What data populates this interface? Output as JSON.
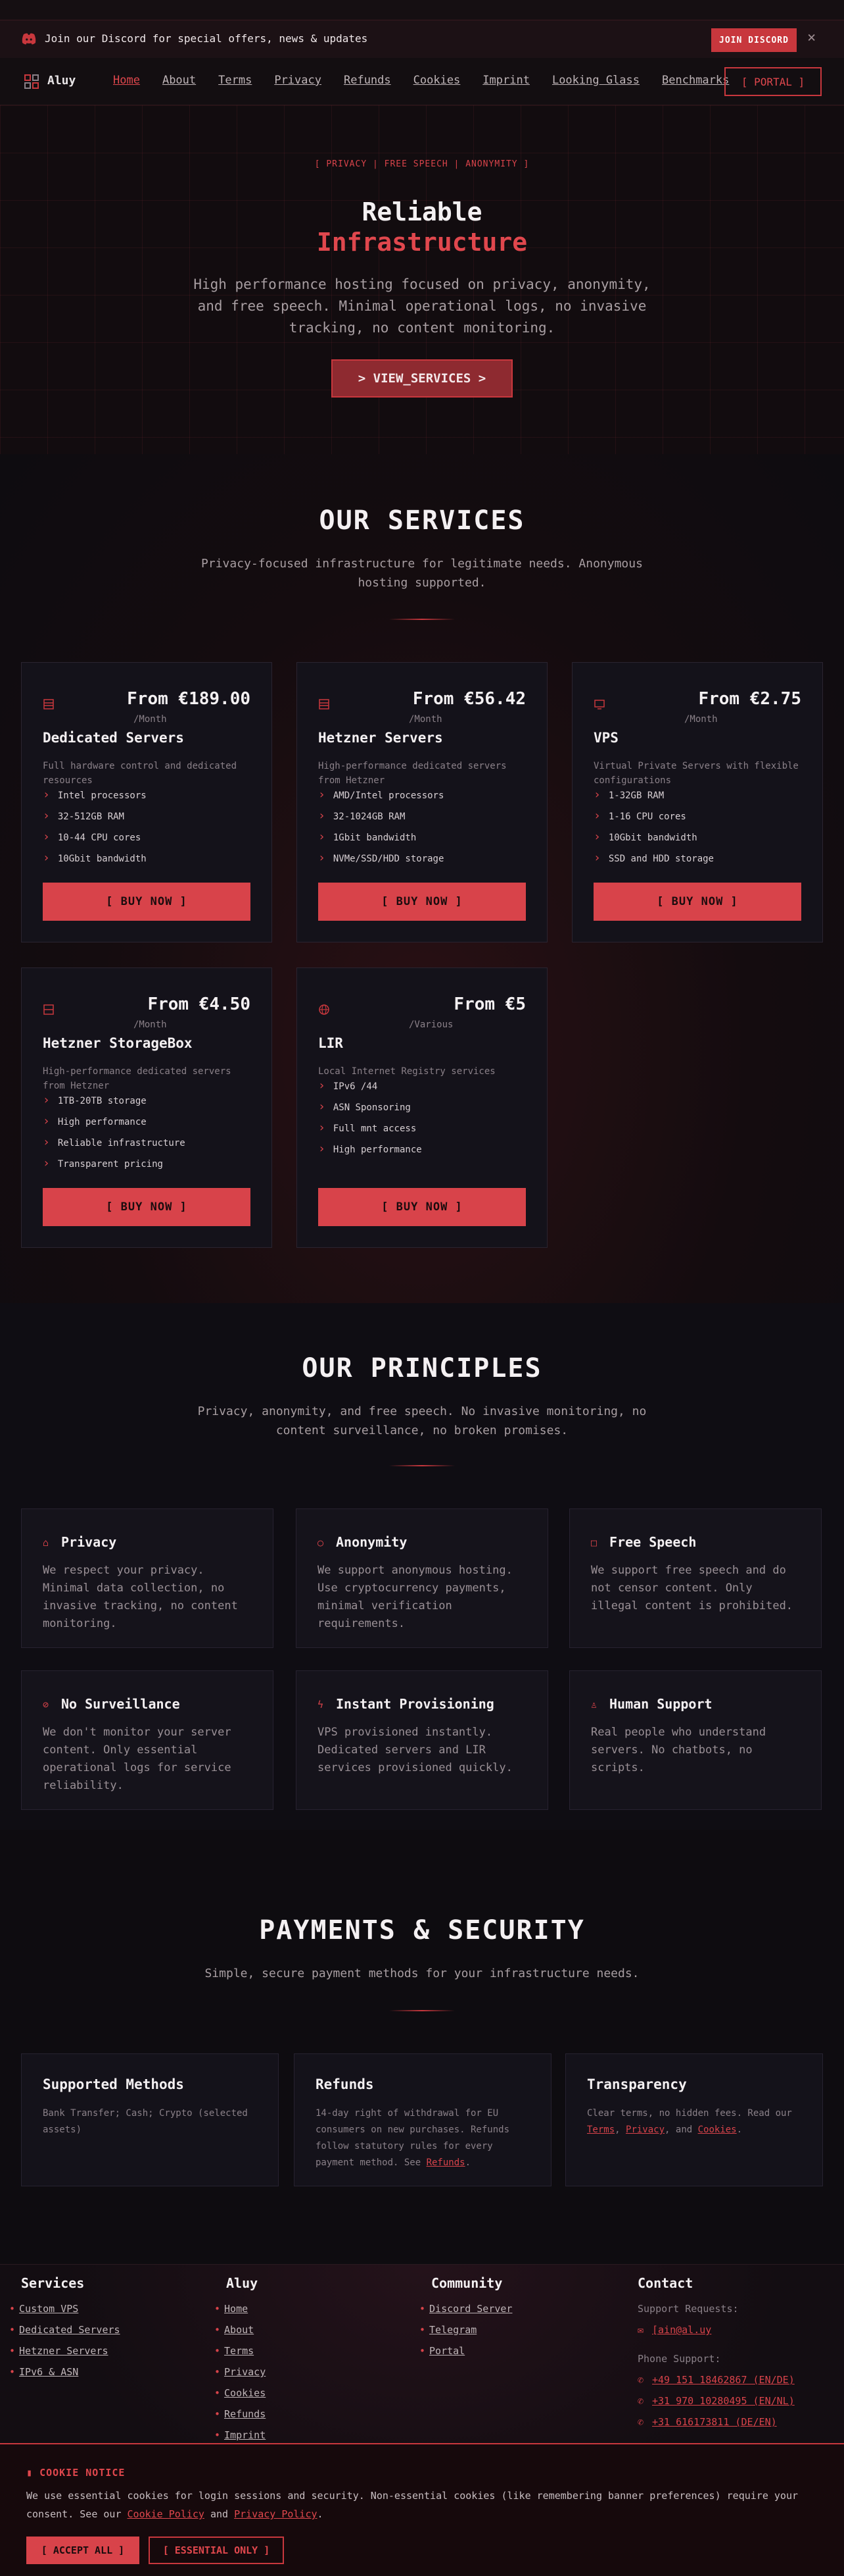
{
  "discord_bar": {
    "text": "Join our Discord for special offers, news & updates",
    "button": "JOIN DISCORD",
    "close": "×"
  },
  "nav": {
    "logo": "Aluy",
    "links": [
      "Home",
      "About",
      "Terms",
      "Privacy",
      "Refunds",
      "Cookies",
      "Imprint",
      "Looking Glass",
      "Benchmarks"
    ],
    "portal": "[ PORTAL ]"
  },
  "hero": {
    "tag": "[ PRIVACY | FREE SPEECH | ANONYMITY ]",
    "title_line1": "Reliable",
    "title_line2": "Infrastructure",
    "subtitle": "High performance hosting focused on privacy, anonymity, and free speech. Minimal operational logs, no invasive tracking, no content monitoring.",
    "cta": "> VIEW_SERVICES >"
  },
  "services": {
    "title": "OUR SERVICES",
    "subtitle": "Privacy-focused infrastructure for legitimate needs. Anonymous hosting supported.",
    "cards": [
      {
        "price": "From €189.00",
        "period": "/Month",
        "title": "Dedicated Servers",
        "desc": "Full hardware control and dedicated resources",
        "features": [
          "Intel processors",
          "32-512GB RAM",
          "10-44 CPU cores",
          "10Gbit bandwidth"
        ],
        "button": "[ BUY NOW ]"
      },
      {
        "price": "From €56.42",
        "period": "/Month",
        "title": "Hetzner Servers",
        "desc": "High-performance dedicated servers from Hetzner",
        "features": [
          "AMD/Intel processors",
          "32-1024GB RAM",
          "1Gbit bandwidth",
          "NVMe/SSD/HDD storage"
        ],
        "button": "[ BUY NOW ]"
      },
      {
        "price": "From €2.75",
        "period": "/Month",
        "title": "VPS",
        "desc": "Virtual Private Servers with flexible configurations",
        "features": [
          "1-32GB RAM",
          "1-16 CPU cores",
          "10Gbit bandwidth",
          "SSD and HDD storage"
        ],
        "button": "[ BUY NOW ]"
      },
      {
        "price": "From €4.50",
        "period": "/Month",
        "title": "Hetzner StorageBox",
        "desc": "High-performance dedicated servers from Hetzner",
        "features": [
          "1TB-20TB storage",
          "High performance",
          "Reliable infrastructure",
          "Transparent pricing"
        ],
        "button": "[ BUY NOW ]"
      },
      {
        "price": "From €5",
        "period": "/Various",
        "title": "LIR",
        "desc": "Local Internet Registry services",
        "features": [
          "IPv6 /44",
          "ASN Sponsoring",
          "Full mnt access",
          "High performance"
        ],
        "button": "[ BUY NOW ]"
      }
    ]
  },
  "principles": {
    "title": "OUR PRINCIPLES",
    "subtitle": "Privacy, anonymity, and free speech. No invasive monitoring, no content surveillance, no broken promises.",
    "cards": [
      {
        "icon": "lock-icon",
        "title": "Privacy",
        "text": "We respect your privacy. Minimal data collection, no invasive tracking, no content monitoring."
      },
      {
        "icon": "mask-icon",
        "title": "Anonymity",
        "text": "We support anonymous hosting. Use cryptocurrency payments, minimal verification requirements."
      },
      {
        "icon": "speech-icon",
        "title": "Free Speech",
        "text": "We support free speech and do not censor content. Only illegal content is prohibited."
      },
      {
        "icon": "no-eye-icon",
        "title": "No Surveillance",
        "text": "We don't monitor your server content. Only essential operational logs for service reliability."
      },
      {
        "icon": "bolt-icon",
        "title": "Instant Provisioning",
        "text": "VPS provisioned instantly. Dedicated servers and LIR services provisioned quickly."
      },
      {
        "icon": "person-icon",
        "title": "Human Support",
        "text": "Real people who understand servers. No chatbots, no scripts."
      }
    ]
  },
  "payments": {
    "title": "PAYMENTS & SECURITY",
    "subtitle": "Simple, secure payment methods for your infrastructure needs.",
    "methods": {
      "title": "Supported Methods",
      "text": "Bank Transfer; Cash; Crypto (selected assets)"
    },
    "refunds": {
      "title": "Refunds",
      "text": "14-day right of withdrawal for EU consumers on new purchases. Refunds follow statutory rules for every payment method. See ",
      "link": "Refunds",
      "end": "."
    },
    "transparency": {
      "title": "Transparency",
      "text": "Clear terms, no hidden fees. Read our ",
      "link1": "Terms",
      "sep1": ", ",
      "link2": "Privacy",
      "sep2": ", and ",
      "link3": "Cookies",
      "end": "."
    }
  },
  "footer": {
    "services": {
      "title": "Services",
      "links": [
        "Custom VPS",
        "Dedicated Servers",
        "Hetzner Servers",
        "IPv6 & ASN"
      ]
    },
    "aluy": {
      "title": "Aluy",
      "links": [
        "Home",
        "About",
        "Terms",
        "Privacy",
        "Cookies",
        "Refunds",
        "Imprint"
      ]
    },
    "community": {
      "title": "Community",
      "links": [
        "Discord Server",
        "Telegram",
        "Portal"
      ]
    },
    "contact": {
      "title": "Contact",
      "support_label": "Support Requests:",
      "email": "[ain@al.uy",
      "phone_label": "Phone Support:",
      "phones": [
        "+49 151 18462867 (EN/DE)",
        "+31 970 10280495 (EN/NL)",
        "+31 616173811 (DE/EN)"
      ]
    }
  },
  "cookie": {
    "title": "COOKIE NOTICE",
    "text": "We use essential cookies for login sessions and security. Non-essential cookies (like remembering banner preferences) require your consent. See our ",
    "link1": "Cookie Policy",
    "mid": " and ",
    "link2": "Privacy Policy",
    "end": ".",
    "accept": "[ ACCEPT ALL ]",
    "essential": "[ ESSENTIAL ONLY ]"
  }
}
